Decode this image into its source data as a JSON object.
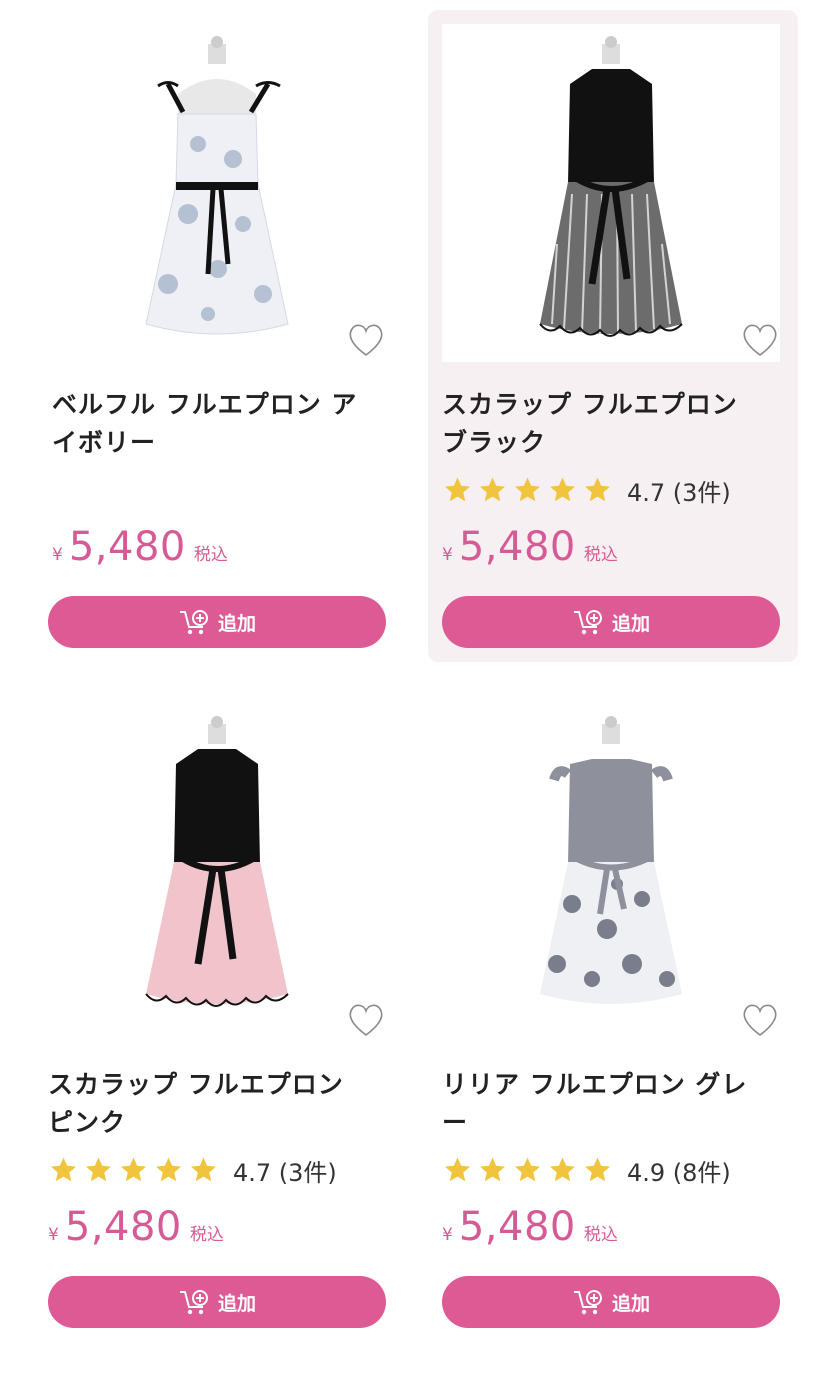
{
  "products": [
    {
      "title_line1": "ベルフル フルエプロン ア",
      "title_line2": "イボリー",
      "stars": 0,
      "rating": "",
      "yen": "¥",
      "price": "5,480",
      "tax": "税込",
      "button": "追加"
    },
    {
      "title_line1": "スカラップ フルエプロン",
      "title_line2": "ブラック",
      "stars": 5,
      "rating": "4.7 (3件)",
      "yen": "¥",
      "price": "5,480",
      "tax": "税込",
      "button": "追加"
    },
    {
      "title_line1": "スカラップ フルエプロン",
      "title_line2": "ピンク",
      "stars": 5,
      "rating": "4.7 (3件)",
      "yen": "¥",
      "price": "5,480",
      "tax": "税込",
      "button": "追加"
    },
    {
      "title_line1": "リリア フルエプロン グレ",
      "title_line2": "ー",
      "stars": 5,
      "rating": "4.9 (8件)",
      "yen": "¥",
      "price": "5,480",
      "tax": "税込",
      "button": "追加"
    }
  ],
  "colors": {
    "accent": "#de5a95",
    "price": "#d65a95",
    "star": "#f0c43c",
    "highlight_bg": "#f7f0f2"
  },
  "icons": {
    "favorite": "heart-icon",
    "cart": "cart-add-icon",
    "rating": "star-icon"
  }
}
